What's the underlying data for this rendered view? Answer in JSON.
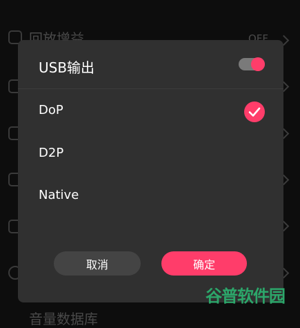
{
  "background": {
    "top_item_label": "回放增益",
    "top_item_value": "OFF",
    "bottom_item_label": "音量数据库"
  },
  "dialog": {
    "title": "USB输出",
    "toggle_on": true,
    "options": [
      {
        "label": "DoP",
        "selected": true
      },
      {
        "label": "D2P",
        "selected": false
      },
      {
        "label": "Native",
        "selected": false
      }
    ],
    "cancel_label": "取消",
    "ok_label": "确定"
  },
  "watermark": "谷普软件园",
  "colors": {
    "accent": "#ff3d6a",
    "dialog_bg": "#303030",
    "watermark": "#2ca66a"
  }
}
